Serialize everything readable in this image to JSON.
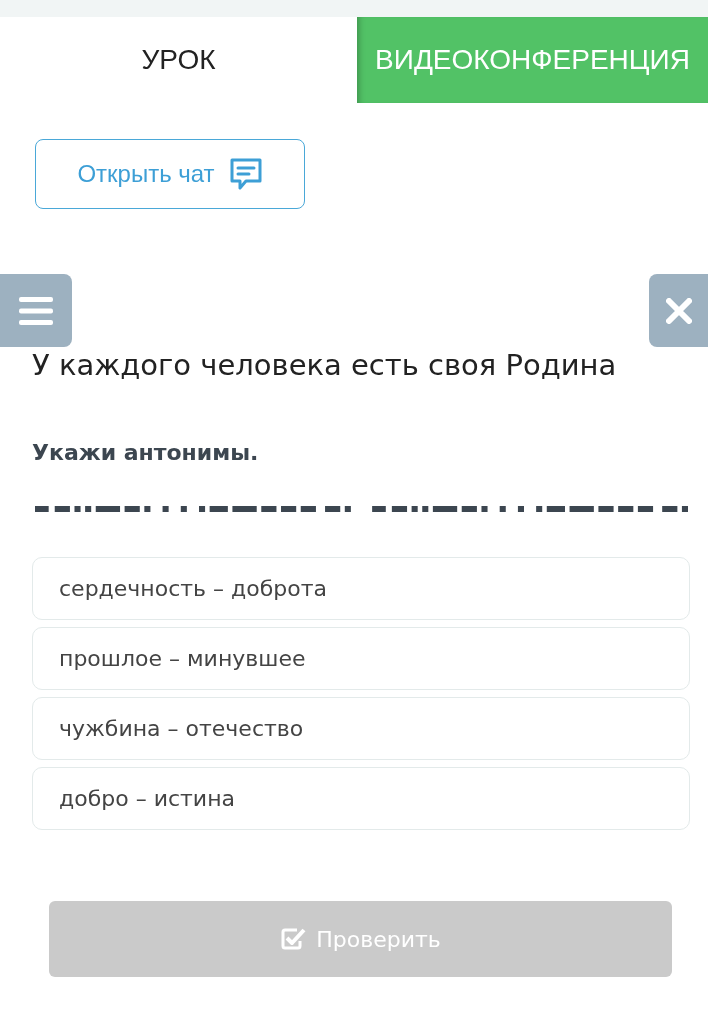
{
  "tabs": [
    {
      "label": "УРОК",
      "selected": true
    },
    {
      "label": "ВИДЕОКОНФЕРЕНЦИЯ",
      "selected": false
    }
  ],
  "chat_button": {
    "label": "Открыть чат"
  },
  "lesson": {
    "title": "У каждого человека есть своя Родина",
    "instruction": "Укажи антонимы."
  },
  "options": [
    {
      "text": "сердечность – доброта",
      "selected": false
    },
    {
      "text": "прошлое – минувшее",
      "selected": false
    },
    {
      "text": "чужбина – отечество",
      "selected": false
    },
    {
      "text": "добро – истина",
      "selected": false
    }
  ],
  "check_button": {
    "label": "Проверить",
    "disabled": true
  }
}
